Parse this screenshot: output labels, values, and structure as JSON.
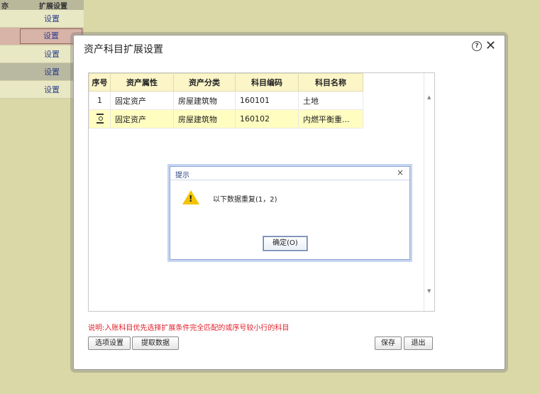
{
  "background_list": {
    "header": {
      "col1": "亦",
      "col2": "扩展设置"
    },
    "rows": [
      {
        "action": "设置"
      },
      {
        "action": "设置"
      },
      {
        "action": "设置"
      },
      {
        "action": "设置"
      },
      {
        "action": "设置"
      }
    ]
  },
  "dialog": {
    "title": "资产科目扩展设置",
    "help_icon": "question-circle-icon",
    "close_icon": "close-icon",
    "columns": [
      "序号",
      "资产属性",
      "资产分类",
      "科目编码",
      "科目名称"
    ],
    "rows": [
      {
        "index": "1",
        "attr": "固定资产",
        "category": "房屋建筑物",
        "code": "160101",
        "name": "土地"
      },
      {
        "index": "",
        "attr": "固定资产",
        "category": "房屋建筑物",
        "code": "160102",
        "name": "内燃平衡重..."
      }
    ],
    "note": "说明:入账科目优先选择扩展条件完全匹配的或序号较小行的科目",
    "buttons": {
      "options": "选项设置",
      "fetch": "提取数据",
      "save": "保存",
      "exit": "退出"
    }
  },
  "message_box": {
    "title": "提示",
    "close": "×",
    "icon": "warning-icon",
    "text": "以下数据重复(1，2)",
    "ok_label": "确定(O)"
  },
  "colors": {
    "background": "#d9d8a6",
    "header_fill": "#fbf5c8",
    "selected_row": "#fffdc0",
    "note_red": "#e0202a"
  }
}
